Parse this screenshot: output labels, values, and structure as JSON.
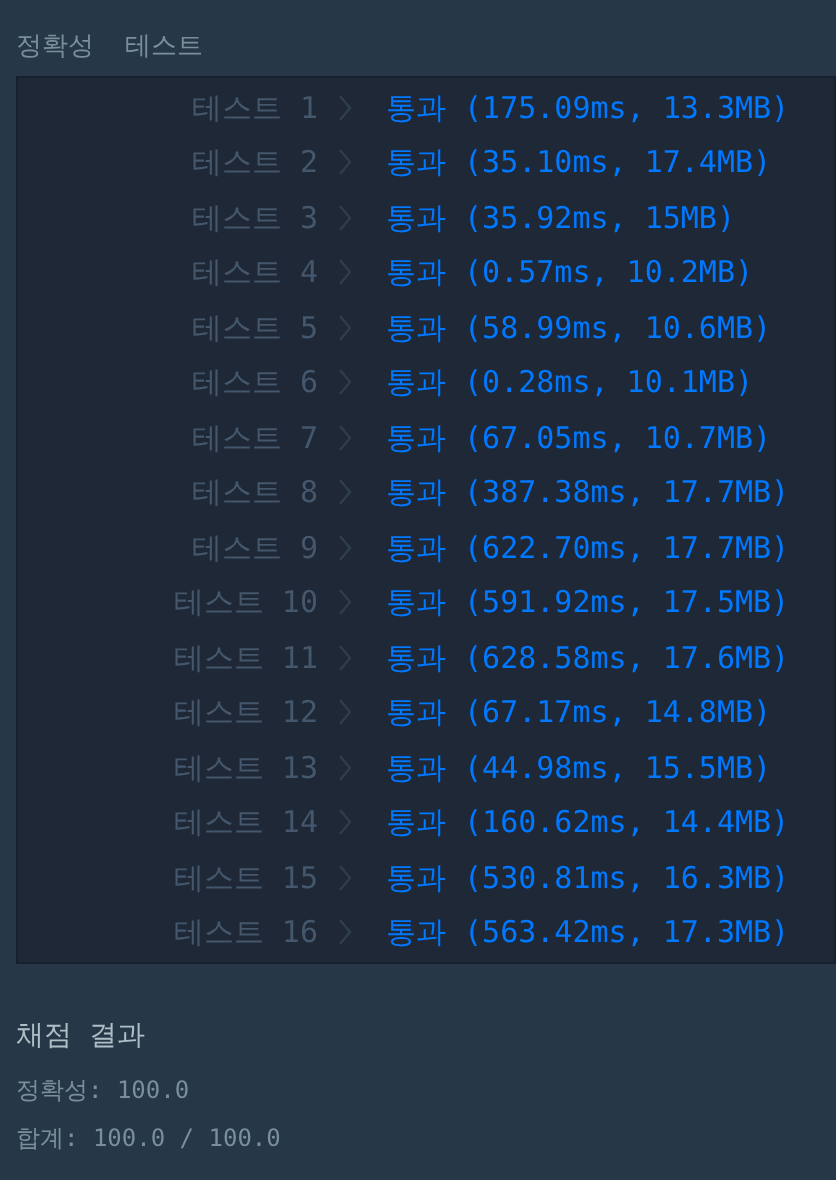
{
  "header": {
    "title": "정확성  테스트"
  },
  "tests": [
    {
      "label": "테스트 1",
      "result": "통과 (175.09ms, 13.3MB)"
    },
    {
      "label": "테스트 2",
      "result": "통과 (35.10ms, 17.4MB)"
    },
    {
      "label": "테스트 3",
      "result": "통과 (35.92ms, 15MB)"
    },
    {
      "label": "테스트 4",
      "result": "통과 (0.57ms, 10.2MB)"
    },
    {
      "label": "테스트 5",
      "result": "통과 (58.99ms, 10.6MB)"
    },
    {
      "label": "테스트 6",
      "result": "통과 (0.28ms, 10.1MB)"
    },
    {
      "label": "테스트 7",
      "result": "통과 (67.05ms, 10.7MB)"
    },
    {
      "label": "테스트 8",
      "result": "통과 (387.38ms, 17.7MB)"
    },
    {
      "label": "테스트 9",
      "result": "통과 (622.70ms, 17.7MB)"
    },
    {
      "label": "테스트 10",
      "result": "통과 (591.92ms, 17.5MB)"
    },
    {
      "label": "테스트 11",
      "result": "통과 (628.58ms, 17.6MB)"
    },
    {
      "label": "테스트 12",
      "result": "통과 (67.17ms, 14.8MB)"
    },
    {
      "label": "테스트 13",
      "result": "통과 (44.98ms, 15.5MB)"
    },
    {
      "label": "테스트 14",
      "result": "통과 (160.62ms, 14.4MB)"
    },
    {
      "label": "테스트 15",
      "result": "통과 (530.81ms, 16.3MB)"
    },
    {
      "label": "테스트 16",
      "result": "통과 (563.42ms, 17.3MB)"
    }
  ],
  "summary": {
    "title": "채점 결과",
    "accuracy": "정확성: 100.0",
    "total": "합계: 100.0 / 100.0"
  }
}
